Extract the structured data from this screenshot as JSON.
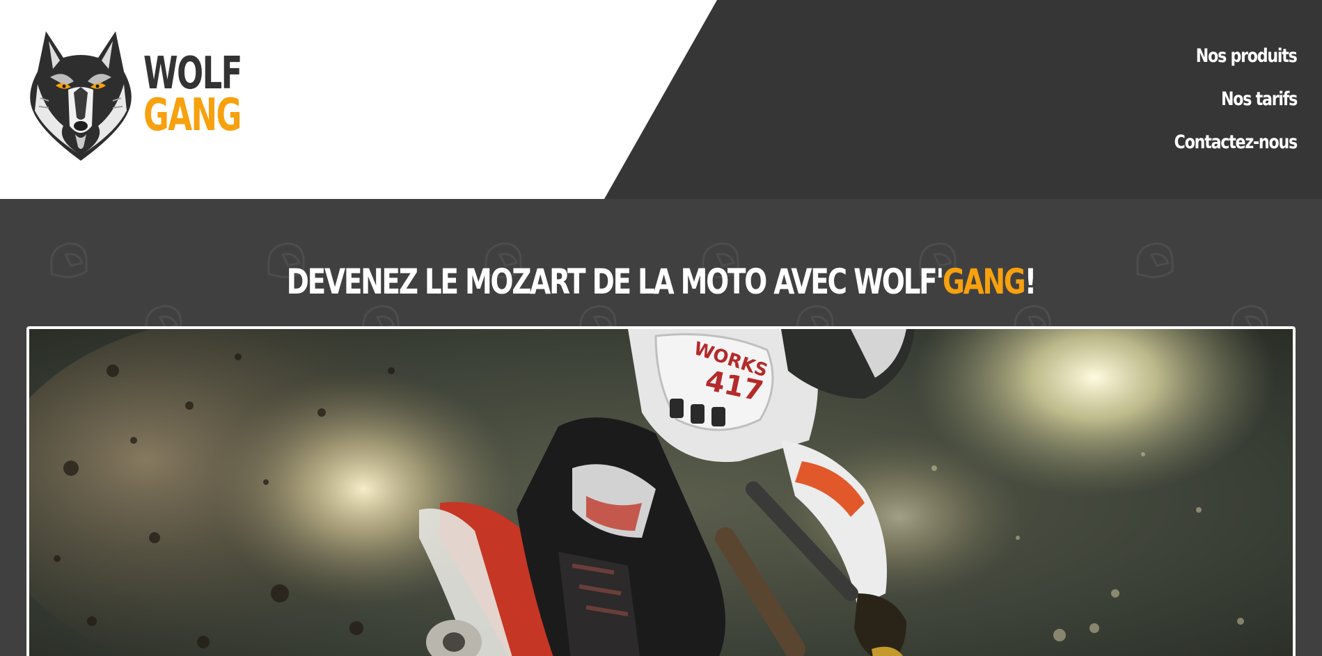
{
  "header": {
    "logo": {
      "word_1": "WOLF",
      "word_2": "GANG",
      "icon": "wolf-head-icon"
    },
    "nav": [
      {
        "label": "Nos produits"
      },
      {
        "label": "Nos tarifs"
      },
      {
        "label": "Contactez-nous"
      }
    ]
  },
  "main": {
    "headline": {
      "text": "DEVENEZ LE MOZART DE LA MOTO AVEC WOLF'",
      "accent": "GANG",
      "suffix": "!"
    },
    "background_icon": "helmet-icon",
    "hero_image": {
      "icon": "motocross-rider-photo",
      "jersey_text_1": "WORKS",
      "jersey_text_2": "417"
    }
  },
  "colors": {
    "accent": "#f7a10e",
    "header_dark": "#363636",
    "background": "#404040",
    "text_light": "#ffffff",
    "logo_dark": "#333333"
  }
}
